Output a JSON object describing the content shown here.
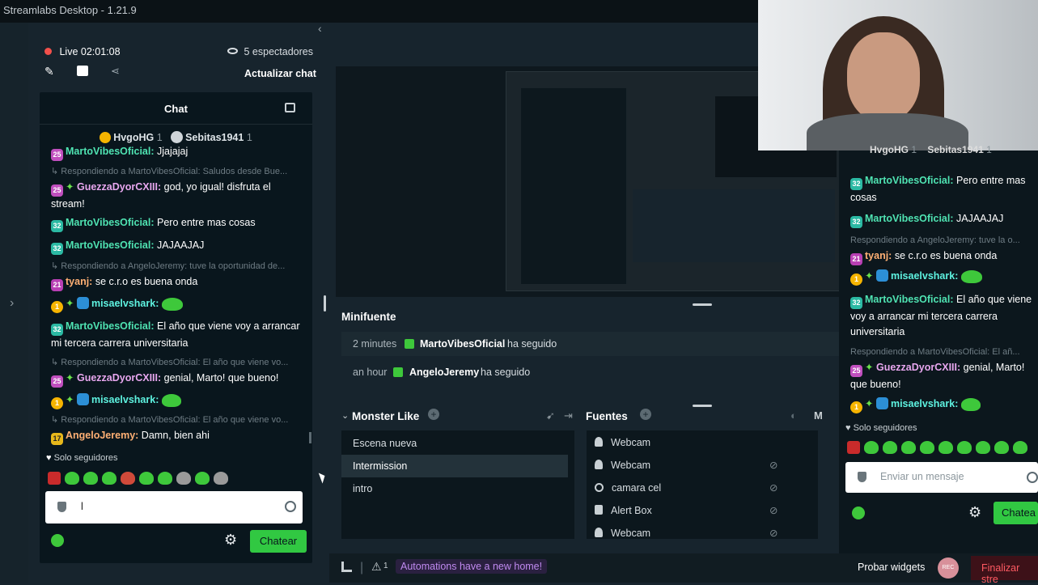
{
  "app": {
    "title": "Streamlabs Desktop - 1.21.9"
  },
  "live": {
    "timer": "Live 02:01:08",
    "viewers": "5 espectadores",
    "refresh_chat": "Actualizar chat"
  },
  "chat": {
    "title": "Chat",
    "top_users": [
      {
        "name": "HvgoHG",
        "count": "1"
      },
      {
        "name": "Sebitas1941",
        "count": "1"
      }
    ],
    "messages": [
      {
        "reply": "",
        "user": "MartoVibesOficial:",
        "text": " Jjajajaj"
      },
      {
        "reply": "Respondiendo a MartoVibesOficial: Saludos desde Bue...",
        "user": "GuezzaDyorCXIII:",
        "text": " god, yo igual! disfruta el stream!"
      },
      {
        "reply": "",
        "user": "MartoVibesOficial:",
        "text": " Pero entre mas cosas"
      },
      {
        "reply": "",
        "user": "MartoVibesOficial:",
        "text": " JAJAAJAJ"
      },
      {
        "reply": "Respondiendo a AngeloJeremy: tuve la oportunidad de...",
        "user": "tyanj:",
        "text": " se c.r.o es buena onda"
      },
      {
        "reply": "",
        "user": "misaelvshark:",
        "text": ""
      },
      {
        "reply": "",
        "user": "MartoVibesOficial:",
        "text": " El año que viene voy a arrancar mi tercera carrera universitaria"
      },
      {
        "reply": "Respondiendo a MartoVibesOficial: El año que viene vo...",
        "user": "GuezzaDyorCXIII:",
        "text": " genial, Marto! que bueno!"
      },
      {
        "reply": "",
        "user": "misaelvshark:",
        "text": ""
      },
      {
        "reply": "Respondiendo a MartoVibesOficial: El año que viene vo...",
        "user": "AngeloJeremy:",
        "text": " Damn, bien ahi"
      }
    ],
    "followers_only": "Solo seguidores",
    "input_value": "l",
    "send_button": "Chatear"
  },
  "mini": {
    "title": "Minifuente",
    "events": [
      {
        "time": "2 minutes",
        "user": "MartoVibesOficial",
        "action": "ha seguido"
      },
      {
        "time": "an hour",
        "user": "AngeloJeremy",
        "action": "ha seguido"
      }
    ]
  },
  "scenes": {
    "collection": "Monster Like",
    "items": [
      "Escena nueva",
      "Intermission",
      "intro"
    ],
    "selected": "Intermission"
  },
  "sources": {
    "title": "Fuentes",
    "items": [
      "Webcam",
      "Webcam",
      "camara cel",
      "Alert Box",
      "Webcam"
    ]
  },
  "footer": {
    "automations": "Automations have a new home!",
    "alert_count": "1",
    "try_widgets": "Probar widgets",
    "rec": "REC",
    "end_stream": "Finalizar stre"
  },
  "overlay_chat": {
    "top_users": [
      {
        "name": "HvgoHG",
        "count": "1"
      },
      {
        "name": "Sebitas1941",
        "count": "1"
      }
    ],
    "messages": [
      {
        "reply": "",
        "user": "MartoVibesOficial:",
        "text": " Pero entre mas cosas"
      },
      {
        "reply": "",
        "user": "MartoVibesOficial:",
        "text": " JAJAAJAJ"
      },
      {
        "reply": "Respondiendo a AngeloJeremy: tuve la o...",
        "user": "tyanj:",
        "text": " se c.r.o es buena onda"
      },
      {
        "reply": "",
        "user": "misaelvshark:",
        "text": ""
      },
      {
        "reply": "",
        "user": "MartoVibesOficial:",
        "text": " El año que viene voy a arrancar mi tercera carrera universitaria"
      },
      {
        "reply": "Respondiendo a MartoVibesOficial: El añ...",
        "user": "GuezzaDyorCXIII:",
        "text": " genial, Marto! que bueno!"
      },
      {
        "reply": "",
        "user": "misaelvshark:",
        "text": ""
      }
    ],
    "followers_only": "Solo seguidores",
    "placeholder": "Enviar un mensaje",
    "send_button": "Chatea"
  }
}
